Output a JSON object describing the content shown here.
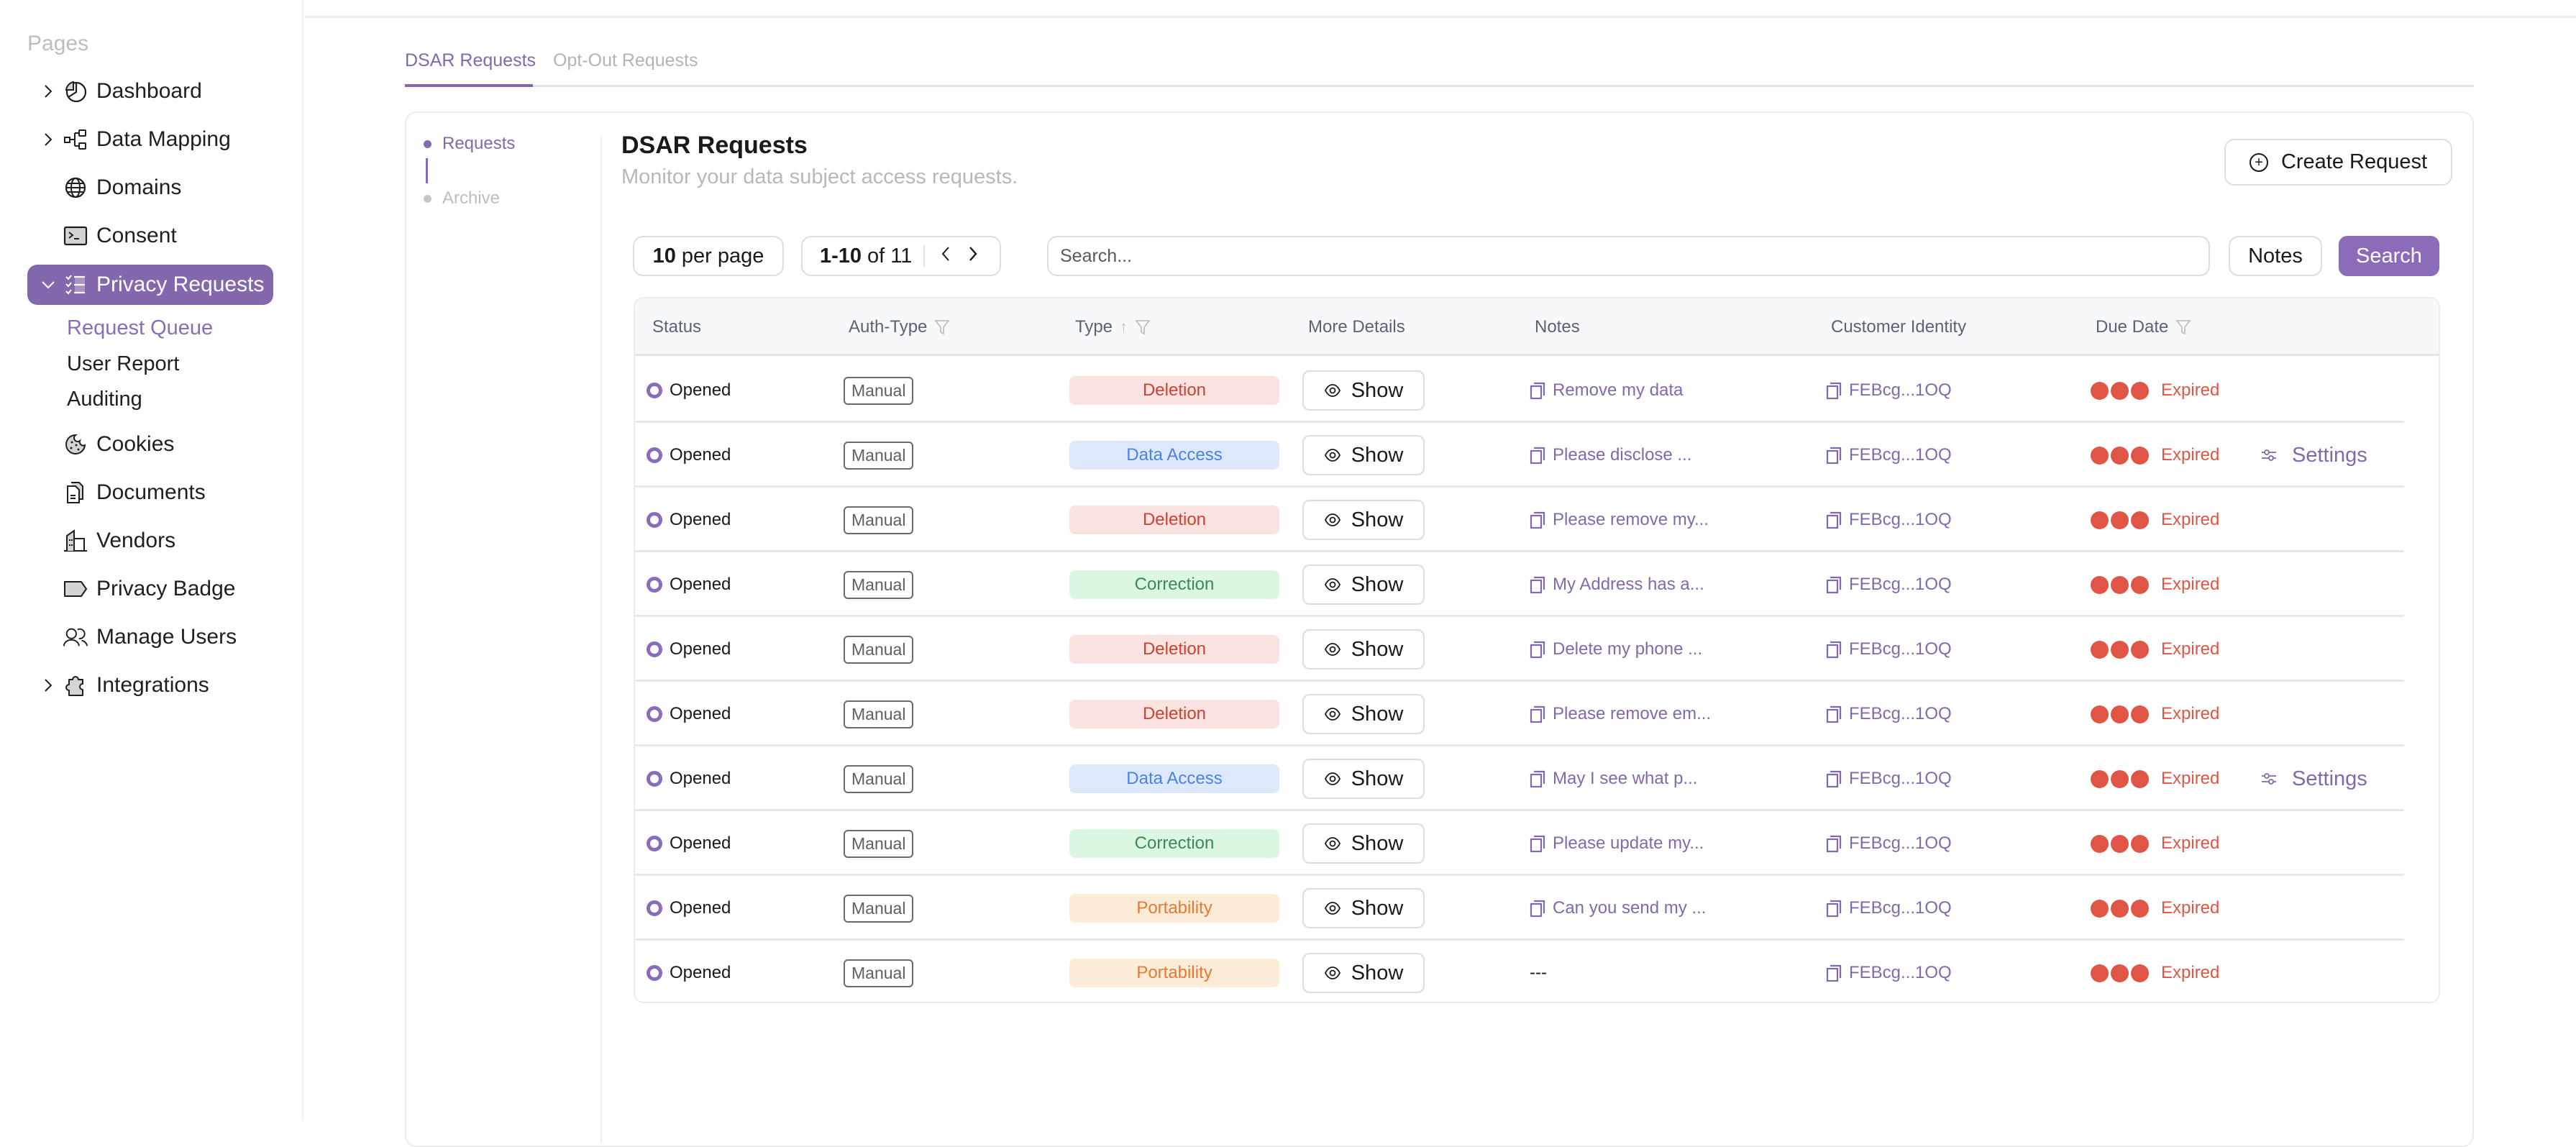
{
  "sidebar": {
    "section_label": "Pages",
    "items": [
      {
        "label": "Dashboard",
        "icon": "pie-chart-icon",
        "expandable": true,
        "expanded": false
      },
      {
        "label": "Data Mapping",
        "icon": "hierarchy-icon",
        "expandable": true,
        "expanded": false
      },
      {
        "label": "Domains",
        "icon": "globe-icon",
        "expandable": false
      },
      {
        "label": "Consent",
        "icon": "terminal-icon",
        "expandable": false
      },
      {
        "label": "Privacy Requests",
        "icon": "checklist-icon",
        "expandable": true,
        "expanded": true,
        "active": true
      },
      {
        "label": "Cookies",
        "icon": "cookie-icon",
        "expandable": false
      },
      {
        "label": "Documents",
        "icon": "documents-icon",
        "expandable": false
      },
      {
        "label": "Vendors",
        "icon": "building-icon",
        "expandable": false
      },
      {
        "label": "Privacy Badge",
        "icon": "tag-icon",
        "expandable": false
      },
      {
        "label": "Manage Users",
        "icon": "users-icon",
        "expandable": false
      },
      {
        "label": "Integrations",
        "icon": "puzzle-icon",
        "expandable": true,
        "expanded": false
      }
    ],
    "sub_items": [
      {
        "label": "Request Queue",
        "active": true
      },
      {
        "label": "User Report",
        "active": false
      },
      {
        "label": "Auditing",
        "active": false
      }
    ]
  },
  "tabs": [
    {
      "label": "DSAR Requests",
      "active": true
    },
    {
      "label": "Opt-Out Requests",
      "active": false
    }
  ],
  "inner_nav": [
    {
      "label": "Requests",
      "active": true
    },
    {
      "label": "Archive",
      "active": false
    }
  ],
  "header": {
    "title": "DSAR Requests",
    "subtitle": "Monitor your data subject access requests.",
    "create_button": "Create Request"
  },
  "controls": {
    "per_page_value": "10",
    "per_page_suffix": "per page",
    "range": "1-10",
    "of_label": "of 11",
    "search_placeholder": "Search...",
    "notes_button": "Notes",
    "search_button": "Search"
  },
  "table": {
    "columns": [
      "Status",
      "Auth-Type",
      "Type",
      "More Details",
      "Notes",
      "Customer Identity",
      "Due Date"
    ],
    "show_label": "Show",
    "settings_label": "Settings",
    "type_colors": {
      "Deletion": {
        "bg": "#fae3e1",
        "fg": "#d0402f"
      },
      "Data Access": {
        "bg": "#dde8fb",
        "fg": "#4a82e6"
      },
      "Correction": {
        "bg": "#dbf6e1",
        "fg": "#3a8a55"
      },
      "Portability": {
        "bg": "#fcebd7",
        "fg": "#e67a33"
      }
    },
    "rows": [
      {
        "status": "Opened",
        "auth": "Manual",
        "type": "Deletion",
        "note": "Remove my data",
        "identity": "FEBcg...1OQ",
        "due": "Expired",
        "settings": false
      },
      {
        "status": "Opened",
        "auth": "Manual",
        "type": "Data Access",
        "note": "Please disclose ...",
        "identity": "FEBcg...1OQ",
        "due": "Expired",
        "settings": true
      },
      {
        "status": "Opened",
        "auth": "Manual",
        "type": "Deletion",
        "note": "Please remove my...",
        "identity": "FEBcg...1OQ",
        "due": "Expired",
        "settings": false
      },
      {
        "status": "Opened",
        "auth": "Manual",
        "type": "Correction",
        "note": "My Address has a...",
        "identity": "FEBcg...1OQ",
        "due": "Expired",
        "settings": false
      },
      {
        "status": "Opened",
        "auth": "Manual",
        "type": "Deletion",
        "note": "Delete my phone ...",
        "identity": "FEBcg...1OQ",
        "due": "Expired",
        "settings": false
      },
      {
        "status": "Opened",
        "auth": "Manual",
        "type": "Deletion",
        "note": "Please remove em...",
        "identity": "FEBcg...1OQ",
        "due": "Expired",
        "settings": false
      },
      {
        "status": "Opened",
        "auth": "Manual",
        "type": "Data Access",
        "note": "May I see what p...",
        "identity": "FEBcg...1OQ",
        "due": "Expired",
        "settings": true
      },
      {
        "status": "Opened",
        "auth": "Manual",
        "type": "Correction",
        "note": "Please update my...",
        "identity": "FEBcg...1OQ",
        "due": "Expired",
        "settings": false
      },
      {
        "status": "Opened",
        "auth": "Manual",
        "type": "Portability",
        "note": "Can you send my ...",
        "identity": "FEBcg...1OQ",
        "due": "Expired",
        "settings": false
      },
      {
        "status": "Opened",
        "auth": "Manual",
        "type": "Portability",
        "note": "---",
        "identity": "FEBcg...1OQ",
        "due": "Expired",
        "settings": false
      }
    ]
  },
  "colors": {
    "accent": "#8468ad",
    "expired": "#e05545"
  }
}
